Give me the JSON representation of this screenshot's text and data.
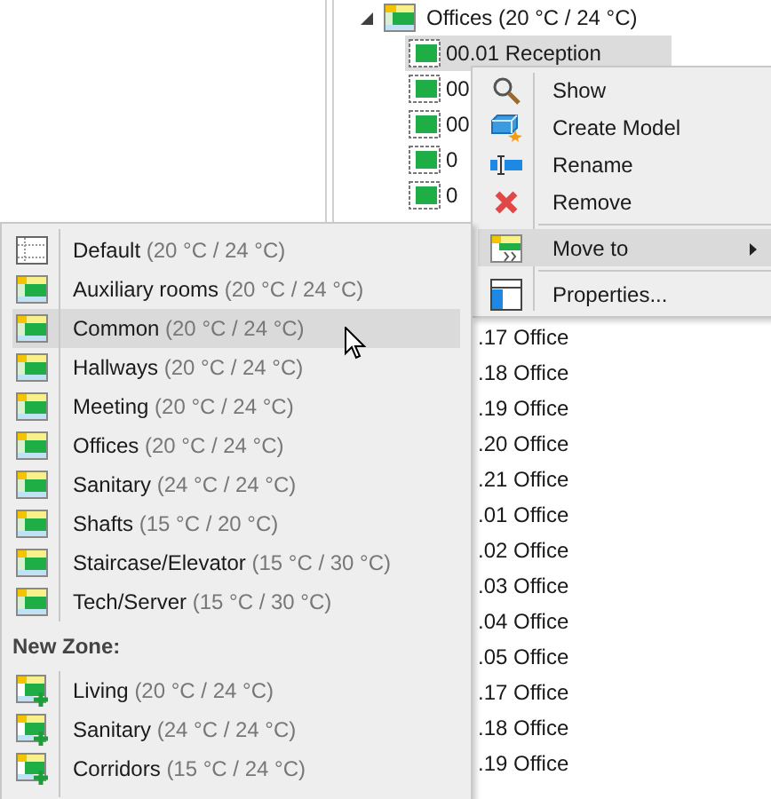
{
  "tree": {
    "parent": {
      "label": "Offices (20 °C / 24 °C)",
      "expanded": true
    },
    "rows": [
      {
        "label": "00.01 Reception",
        "selected": true
      },
      {
        "label": "00",
        "selected": false
      },
      {
        "label": "00",
        "selected": false
      },
      {
        "label": "0",
        "selected": false
      },
      {
        "label": "0",
        "selected": false
      }
    ],
    "lower_rows": [
      {
        "label": ".17 Office"
      },
      {
        "label": ".18 Office"
      },
      {
        "label": ".19 Office"
      },
      {
        "label": ".20 Office"
      },
      {
        "label": ".21 Office"
      },
      {
        "label": ".01 Office"
      },
      {
        "label": ".02 Office"
      },
      {
        "label": ".03 Office"
      },
      {
        "label": ".04 Office"
      },
      {
        "label": ".05 Office"
      },
      {
        "label": ".17 Office"
      },
      {
        "label": ".18 Office"
      },
      {
        "label": ".19 Office"
      }
    ]
  },
  "context_menu": [
    {
      "kind": "show",
      "label": "Show",
      "selected": false
    },
    {
      "kind": "create",
      "label": "Create Model",
      "selected": false
    },
    {
      "kind": "rename",
      "label": "Rename",
      "selected": false
    },
    {
      "kind": "remove",
      "label": "Remove",
      "selected": false
    },
    {
      "kind": "separator"
    },
    {
      "kind": "move",
      "label": "Move to",
      "selected": true,
      "submenu": true
    },
    {
      "kind": "separator"
    },
    {
      "kind": "properties",
      "label": "Properties...",
      "selected": false
    }
  ],
  "submenu": {
    "zones": [
      {
        "kind": "empty",
        "name": "Default",
        "temp": "(20 °C / 24 °C)",
        "selected": false
      },
      {
        "kind": "zone",
        "name": "Auxiliary rooms",
        "temp": "(20 °C / 24 °C)",
        "selected": false
      },
      {
        "kind": "zone",
        "name": "Common",
        "temp": "(20 °C / 24 °C)",
        "selected": true
      },
      {
        "kind": "zone",
        "name": "Hallways",
        "temp": "(20 °C / 24 °C)",
        "selected": false
      },
      {
        "kind": "zone",
        "name": "Meeting",
        "temp": "(20 °C / 24 °C)",
        "selected": false
      },
      {
        "kind": "zone",
        "name": "Offices",
        "temp": "(20 °C / 24 °C)",
        "selected": false
      },
      {
        "kind": "zone",
        "name": "Sanitary",
        "temp": "(24 °C / 24 °C)",
        "selected": false
      },
      {
        "kind": "zone",
        "name": "Shafts",
        "temp": "(15 °C / 20 °C)",
        "selected": false
      },
      {
        "kind": "zone",
        "name": "Staircase/Elevator",
        "temp": "(15 °C / 30 °C)",
        "selected": false
      },
      {
        "kind": "zone",
        "name": "Tech/Server",
        "temp": "(15 °C / 30 °C)",
        "selected": false
      }
    ],
    "new_zone_heading": "New Zone:",
    "new_zones": [
      {
        "name": "Living",
        "temp": "(20 °C / 24 °C)",
        "selected": false
      },
      {
        "name": "Sanitary",
        "temp": "(24 °C / 24 °C)",
        "selected": false
      },
      {
        "name": "Corridors",
        "temp": "(15 °C / 24 °C)",
        "selected": false
      }
    ]
  }
}
